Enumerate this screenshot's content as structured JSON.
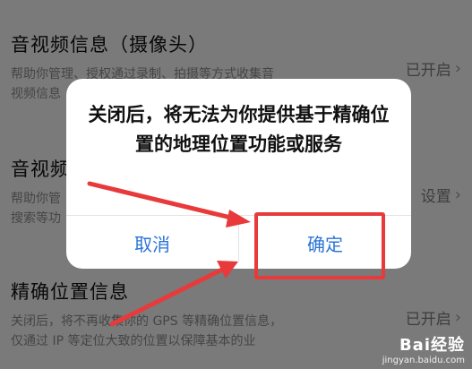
{
  "settings": [
    {
      "title": "音视频信息（摄像头）",
      "desc_lines": [
        "帮助你管理、授权通过录制、拍摄等方式收集音",
        "视频信息"
      ],
      "status": "已开启"
    },
    {
      "title": "音视频",
      "desc_lines": [
        "帮助你管",
        "搜索等功"
      ],
      "status": "设置"
    },
    {
      "title": "精确位置信息",
      "desc_lines": [
        "关闭后，将不再收集你的 GPS 等精确位置信息，",
        "仅通过 IP 等定位大致的位置以保障基本的业"
      ],
      "status": "已开启"
    }
  ],
  "dialog": {
    "message": "关闭后，将无法为你提供基于精确位置的地理位置功能或服务",
    "cancel_label": "取消",
    "confirm_label": "确定"
  },
  "watermark": {
    "logo": "Bai经验",
    "url": "jingyan.baidu.com"
  },
  "colors": {
    "accent": "#2b74d6",
    "highlight": "#e83a3a"
  },
  "icons": {
    "chevron": "chevron-right-icon"
  }
}
